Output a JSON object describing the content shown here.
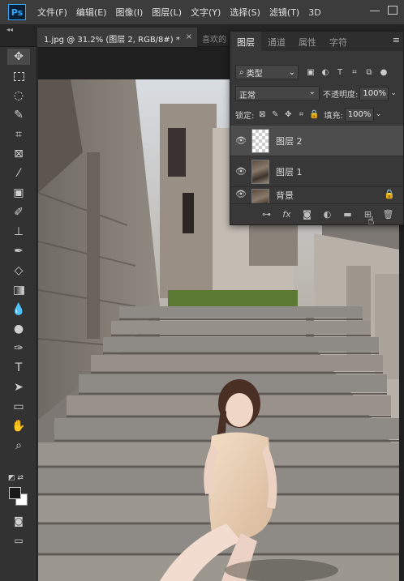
{
  "app": {
    "logo": "Ps"
  },
  "menu": [
    "文件(F)",
    "编辑(E)",
    "图像(I)",
    "图层(L)",
    "文字(Y)",
    "选择(S)",
    "滤镜(T)",
    "3D"
  ],
  "tabs": {
    "active": "1.jpg @ 31.2% (图层 2, RGB/8#) *",
    "active_close": "×",
    "second": "喜欢的"
  },
  "tools": [
    "move-icon",
    "marquee-icon",
    "lasso-icon",
    "quick-select-icon",
    "crop-icon",
    "frame-icon",
    "eyedropper-icon",
    "healing-icon",
    "brush-icon",
    "stamp-icon",
    "history-brush-icon",
    "eraser-icon",
    "gradient-icon",
    "blur-icon",
    "dodge-icon",
    "pen-icon",
    "type-icon",
    "path-select-icon",
    "shape-icon",
    "hand-icon",
    "zoom-icon"
  ],
  "layers_panel": {
    "tabs": [
      "图层",
      "通道",
      "属性",
      "字符"
    ],
    "menu_icon": "≡",
    "filter_label": "类型",
    "blend_mode": "正常",
    "opacity_label": "不透明度:",
    "opacity_value": "100%",
    "lock_label": "锁定:",
    "fill_label": "填充:",
    "fill_value": "100%",
    "layers": [
      {
        "name": "图层 2",
        "selected": true,
        "thumb": "transparent"
      },
      {
        "name": "图层 1",
        "selected": false,
        "thumb": "image"
      },
      {
        "name": "背景",
        "selected": false,
        "thumb": "image"
      }
    ]
  },
  "colors": {
    "accent": "#31a8ff",
    "menubar": "#3c3c3c",
    "panel": "#383838",
    "selected_row": "#4d4d4d"
  }
}
